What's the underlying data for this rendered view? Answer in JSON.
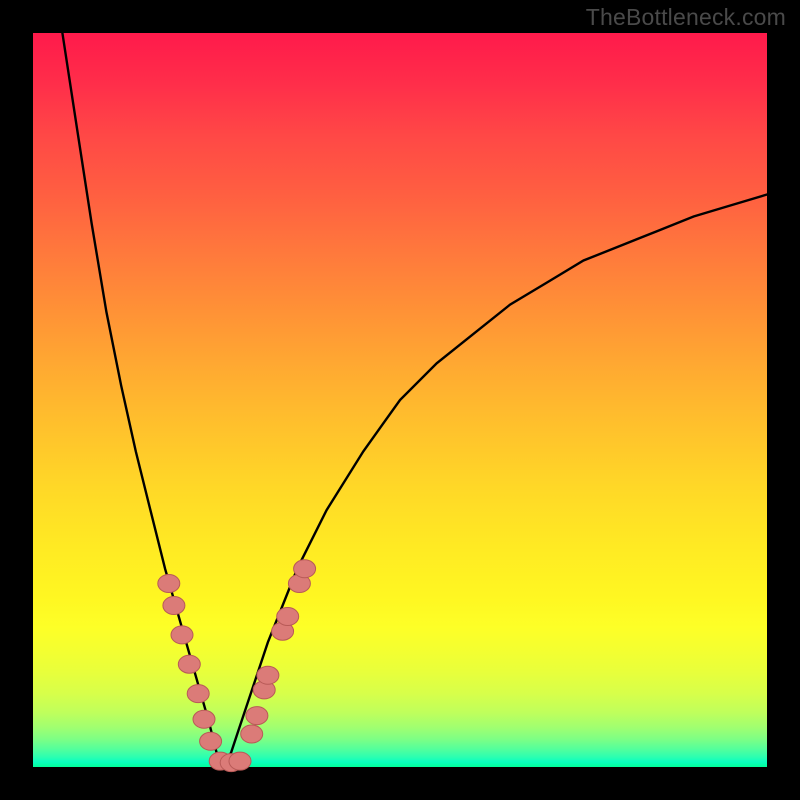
{
  "watermark": "TheBottleneck.com",
  "colors": {
    "background": "#000000",
    "curve": "#000000",
    "marker_fill": "#db7b78",
    "marker_stroke": "#b85a57",
    "gradient_top": "#ff1a4b",
    "gradient_bottom": "#02ff9a"
  },
  "chart_data": {
    "type": "line",
    "title": "",
    "xlabel": "",
    "ylabel": "",
    "xlim": [
      0,
      100
    ],
    "ylim": [
      0,
      100
    ],
    "notes": "V-shaped bottleneck curve on a rainbow gradient. Minimum (0%) near x≈26. Pink oval markers cluster on both branches near the bottom. Values are estimated from pixels.",
    "series": [
      {
        "name": "left-branch",
        "x": [
          4,
          6,
          8,
          10,
          12,
          14,
          16,
          18,
          20,
          22,
          24,
          25,
          26
        ],
        "y": [
          100,
          87,
          74,
          62,
          52,
          43,
          35,
          27,
          20,
          13,
          6,
          2,
          0
        ]
      },
      {
        "name": "right-branch",
        "x": [
          26,
          27,
          28,
          30,
          32,
          34,
          36,
          40,
          45,
          50,
          55,
          60,
          65,
          70,
          75,
          80,
          85,
          90,
          95,
          100
        ],
        "y": [
          0,
          2,
          5,
          11,
          17,
          22,
          27,
          35,
          43,
          50,
          55,
          59,
          63,
          66,
          69,
          71,
          73,
          75,
          76.5,
          78
        ]
      }
    ],
    "markers": [
      {
        "branch": "left",
        "x": 18.5,
        "y": 25
      },
      {
        "branch": "left",
        "x": 19.2,
        "y": 22
      },
      {
        "branch": "left",
        "x": 20.3,
        "y": 18
      },
      {
        "branch": "left",
        "x": 21.3,
        "y": 14
      },
      {
        "branch": "left",
        "x": 22.5,
        "y": 10
      },
      {
        "branch": "left",
        "x": 23.3,
        "y": 6.5
      },
      {
        "branch": "left",
        "x": 24.2,
        "y": 3.5
      },
      {
        "branch": "left",
        "x": 25.5,
        "y": 0.8
      },
      {
        "branch": "left",
        "x": 27.0,
        "y": 0.6
      },
      {
        "branch": "left",
        "x": 28.2,
        "y": 0.8
      },
      {
        "branch": "right",
        "x": 29.8,
        "y": 4.5
      },
      {
        "branch": "right",
        "x": 30.5,
        "y": 7.0
      },
      {
        "branch": "right",
        "x": 31.5,
        "y": 10.5
      },
      {
        "branch": "right",
        "x": 32.0,
        "y": 12.5
      },
      {
        "branch": "right",
        "x": 34.0,
        "y": 18.5
      },
      {
        "branch": "right",
        "x": 34.7,
        "y": 20.5
      },
      {
        "branch": "right",
        "x": 36.3,
        "y": 25.0
      },
      {
        "branch": "right",
        "x": 37.0,
        "y": 27.0
      }
    ]
  }
}
